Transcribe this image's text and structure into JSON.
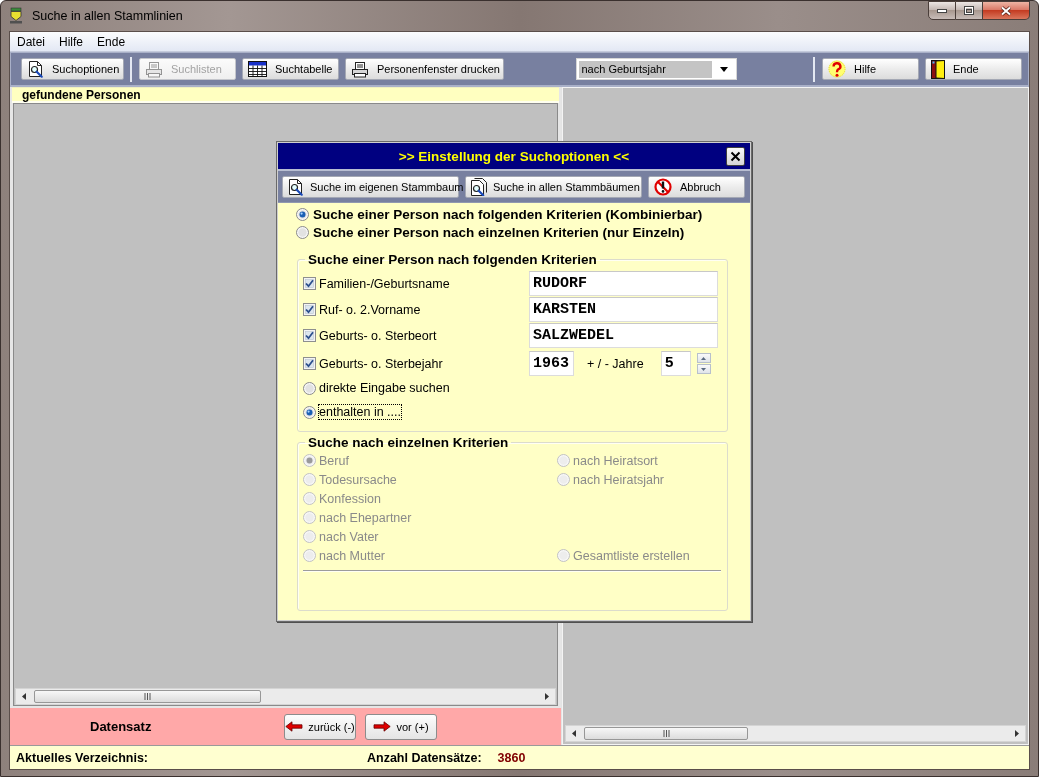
{
  "window": {
    "title": "Suche in allen Stammlinien"
  },
  "menu": [
    {
      "label": "Datei"
    },
    {
      "label": "Hilfe"
    },
    {
      "label": "Ende"
    }
  ],
  "toolbar": [
    {
      "kind": "button",
      "label": "Suchoptionen",
      "disabled": false
    },
    {
      "kind": "separator"
    },
    {
      "kind": "button",
      "label": "Suchlisten",
      "disabled": true
    },
    {
      "kind": "button",
      "label": "Suchtabelle",
      "disabled": false
    },
    {
      "kind": "button",
      "label": "Personenfenster drucken",
      "disabled": false
    },
    {
      "kind": "select",
      "value": "nach Geburtsjahr"
    },
    {
      "kind": "separator"
    },
    {
      "kind": "button",
      "label": "Hilfe",
      "disabled": false
    },
    {
      "kind": "button",
      "label": "Ende",
      "disabled": false
    }
  ],
  "results_panel": {
    "title": "gefundene Personen"
  },
  "record_nav": {
    "label": "Datensatz",
    "buttons": [
      {
        "label": "zurück (-)"
      },
      {
        "label": "vor (+)"
      }
    ]
  },
  "status_bar": {
    "directory_label": "Aktuelles Verzeichnis:",
    "count_label": "Anzahl Datensätze:",
    "count": "3860"
  },
  "dialog": {
    "title": ">> Einstellung der Suchoptionen <<",
    "buttons": [
      {
        "label": "Suche im eigenen Stammbaum"
      },
      {
        "label": "Suche in allen Stammbäumen"
      },
      {
        "label": "Abbruch"
      }
    ],
    "mode_options": [
      {
        "label": "Suche einer Person nach folgenden Kriterien (Kombinierbar)",
        "selected": true
      },
      {
        "label": "Suche einer Person nach einzelnen Kriterien (nur Einzeln)",
        "selected": false
      }
    ],
    "combined_group": {
      "title": "Suche einer Person nach folgenden Kriterien",
      "criteria": [
        {
          "kind": "text",
          "label": "Familien-/Geburtsname",
          "checked": true,
          "value": "RUDORF"
        },
        {
          "kind": "text",
          "label": "Ruf- o. 2.Vorname",
          "checked": true,
          "value": "KARSTEN"
        },
        {
          "kind": "text",
          "label": "Geburts- o. Sterbeort",
          "checked": true,
          "value": "SALZWEDEL"
        },
        {
          "kind": "year",
          "label": "Geburts- o. Sterbejahr",
          "checked": true,
          "value": "1963",
          "range_label": "+ / - Jahre",
          "range_value": "5"
        }
      ],
      "match_options": [
        {
          "label": "direkte Eingabe suchen",
          "selected": false,
          "focused": false
        },
        {
          "label": "enthalten in ....",
          "selected": true,
          "focused": true
        }
      ]
    },
    "single_group": {
      "title": "Suche nach einzelnen Kriterien",
      "disabled": true,
      "rows": [
        {
          "left": {
            "label": "Beruf",
            "selected": true
          },
          "right": {
            "label": "nach Heiratsort",
            "selected": false
          }
        },
        {
          "left": {
            "label": "Todesursache",
            "selected": false
          },
          "right": {
            "label": "nach Heiratsjahr",
            "selected": false
          }
        },
        {
          "left": {
            "label": "Konfession",
            "selected": false
          }
        },
        {
          "left": {
            "label": "nach Ehepartner",
            "selected": false
          }
        },
        {
          "left": {
            "label": "nach Vater",
            "selected": false
          }
        },
        {
          "left": {
            "label": "nach Mutter",
            "selected": false
          },
          "right": {
            "label": "Gesamtliste erstellen",
            "selected": false
          }
        }
      ]
    }
  }
}
